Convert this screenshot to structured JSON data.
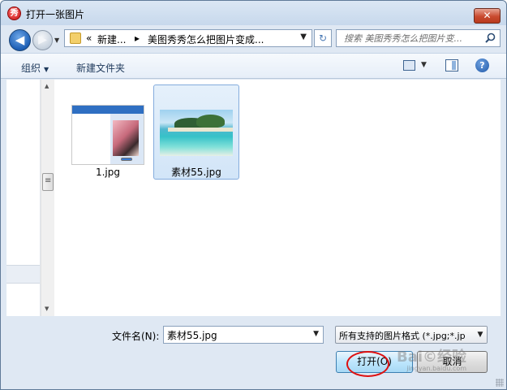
{
  "window": {
    "title": "打开一张图片",
    "app_icon": "秀",
    "close_glyph": "✕"
  },
  "nav": {
    "back_icon": "back-arrow-icon",
    "forward_icon": "forward-arrow-icon",
    "back_glyph": "◀",
    "forward_glyph": "▶"
  },
  "address": {
    "prefix": "«",
    "segment_1": "新建...",
    "segment_2": "美图秀秀怎么把图片变成...",
    "refresh_glyph": "↻"
  },
  "search": {
    "placeholder": "搜索 美图秀秀怎么把图片变..."
  },
  "toolbar": {
    "organize": "组织",
    "new_folder": "新建文件夹",
    "help_glyph": "?"
  },
  "files": [
    {
      "name": "1.jpg",
      "selected": false
    },
    {
      "name": "素材55.jpg",
      "selected": true
    }
  ],
  "bottom": {
    "filename_label": "文件名(N):",
    "filename_value": "素材55.jpg",
    "filter_value": "所有支持的图片格式 (*.jpg;*.jp",
    "open_button": "打开(O)",
    "cancel_button": "取消"
  },
  "watermark": {
    "text": "Bai©经验",
    "sub": "jingyan.baidu.com"
  },
  "colors": {
    "annotation_circle": "#dd1111",
    "selection_border": "#84acdd",
    "titlebar": "#c7d8ec"
  }
}
